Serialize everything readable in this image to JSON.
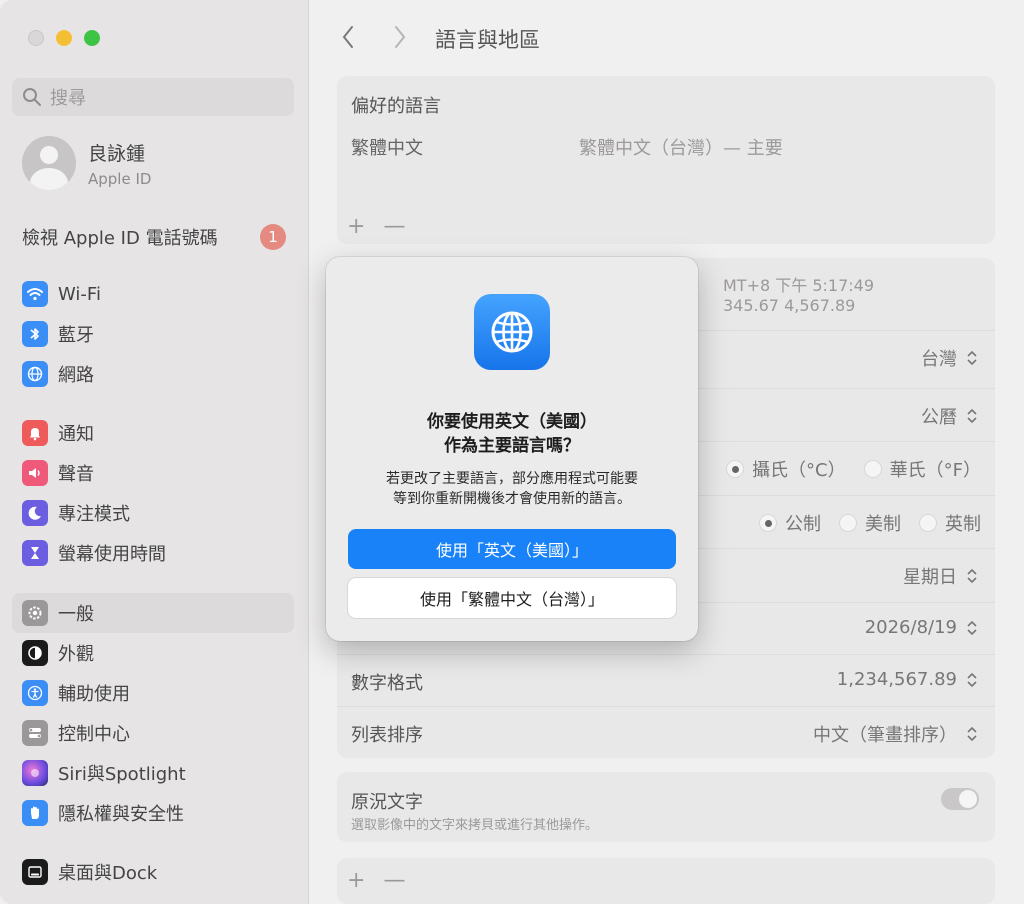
{
  "window": {
    "title": "語言與地區"
  },
  "sidebar": {
    "search_placeholder": "搜尋",
    "account": {
      "name": "良詠鍾",
      "subtitle": "Apple ID"
    },
    "phone_row": {
      "label": "檢視 Apple ID 電話號碼",
      "badge": "1"
    },
    "items": [
      {
        "label": "Wi-Fi",
        "icon": "wifi-icon",
        "color": "#3a8ef6"
      },
      {
        "label": "藍牙",
        "icon": "bluetooth-icon",
        "color": "#3a8ef6"
      },
      {
        "label": "網路",
        "icon": "globe-icon",
        "color": "#3a8ef6"
      },
      {
        "label": "通知",
        "icon": "bell-icon",
        "color": "#ef5a5a"
      },
      {
        "label": "聲音",
        "icon": "speaker-icon",
        "color": "#ef5a7a"
      },
      {
        "label": "專注模式",
        "icon": "moon-icon",
        "color": "#6b5ee0"
      },
      {
        "label": "螢幕使用時間",
        "icon": "hourglass-icon",
        "color": "#6b5ee0"
      },
      {
        "label": "一般",
        "icon": "gear-icon",
        "color": "#9a9898"
      },
      {
        "label": "外觀",
        "icon": "appearance-icon",
        "color": "#1b1b1b"
      },
      {
        "label": "輔助使用",
        "icon": "accessibility-icon",
        "color": "#3a8ef6"
      },
      {
        "label": "控制中心",
        "icon": "switches-icon",
        "color": "#9a9898"
      },
      {
        "label": "Siri與Spotlight",
        "icon": "siri-icon",
        "color": "#b052e0"
      },
      {
        "label": "隱私權與安全性",
        "icon": "hand-icon",
        "color": "#3a8ef6"
      },
      {
        "label": "桌面與Dock",
        "icon": "dock-icon",
        "color": "#1b1b1b"
      }
    ]
  },
  "main": {
    "preferred": {
      "title": "偏好的語言",
      "language": "繁體中文",
      "language_value": "繁體中文（台灣）— 主要",
      "add": "+",
      "remove": "—"
    },
    "time_partial_1": "MT+8 下午 5:17:49",
    "time_partial_2": "345.67     4,567.89",
    "rows": {
      "region_value": "台灣",
      "calendar_value": "公曆",
      "temp_celsius": "攝氏（°C）",
      "temp_fahrenheit": "華氏（°F）",
      "measure_metric": "公制",
      "measure_us": "美制",
      "measure_uk": "英制",
      "first_day_value": "星期日",
      "date_value": "2026/8/19",
      "number_label": "數字格式",
      "number_value": "1,234,567.89",
      "list_label": "列表排序",
      "list_value": "中文（筆畫排序）"
    },
    "live_text": {
      "title": "原況文字",
      "description": "選取影像中的文字來拷貝或進行其他操作。"
    },
    "apps": {
      "add": "+",
      "remove": "—"
    }
  },
  "dialog": {
    "title_line1": "你要使用英文（美國）",
    "title_line2": "作為主要語言嗎？",
    "message_line1": "若更改了主要語言，部分應用程式可能要",
    "message_line2": "等到你重新開機後才會使用新的語言。",
    "primary_button": "使用「英文（美國）」",
    "secondary_button": "使用「繁體中文（台灣）」"
  },
  "colors": {
    "accent": "#1982f8",
    "badge": "#e48a80"
  }
}
